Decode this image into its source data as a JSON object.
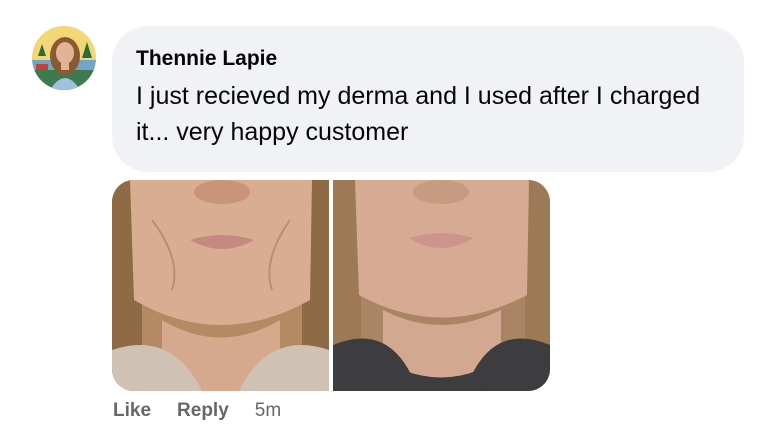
{
  "comment": {
    "author": "Thennie Lapie",
    "text": "I just recieved my derma and I used after I charged it... very happy customer",
    "actions": {
      "like_label": "Like",
      "reply_label": "Reply",
      "timestamp": "5m"
    }
  },
  "colors": {
    "bubble_background": "#f0f2f5",
    "action_text": "#65676b",
    "primary_text": "#050505"
  }
}
